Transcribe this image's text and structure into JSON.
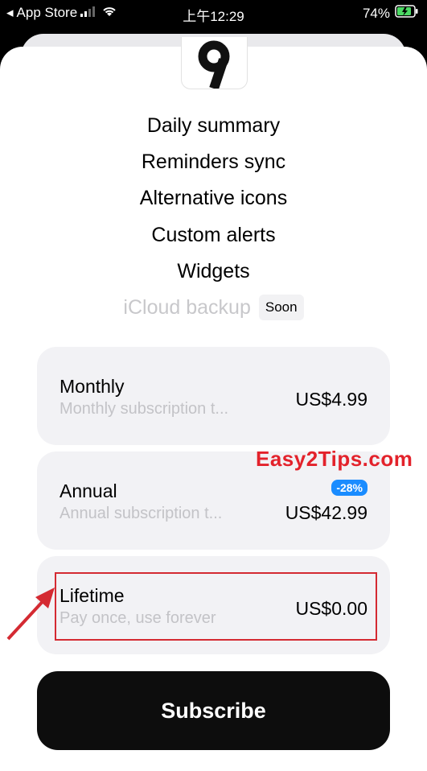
{
  "status_bar": {
    "carrier": "App Store",
    "time": "上午12:29",
    "battery_percent": "74%"
  },
  "app": {
    "logo_glyph": "9"
  },
  "features": [
    "Daily summary",
    "Reminders sync",
    "Alternative icons",
    "Custom alerts",
    "Widgets"
  ],
  "icloud": {
    "label": "iCloud backup",
    "badge": "Soon"
  },
  "plans": [
    {
      "title": "Monthly",
      "subtitle": "Monthly subscription t...",
      "price": "US$4.99"
    },
    {
      "title": "Annual",
      "subtitle": "Annual subscription t...",
      "price": "US$42.99",
      "discount": "-28%"
    },
    {
      "title": "Lifetime",
      "subtitle": "Pay once, use forever",
      "price": "US$0.00"
    }
  ],
  "subscribe_label": "Subscribe",
  "watermark": "Easy2Tips.com",
  "colors": {
    "accent_blue": "#1a8cff",
    "highlight_red": "#d42a32",
    "button_black": "#0d0d0d"
  }
}
